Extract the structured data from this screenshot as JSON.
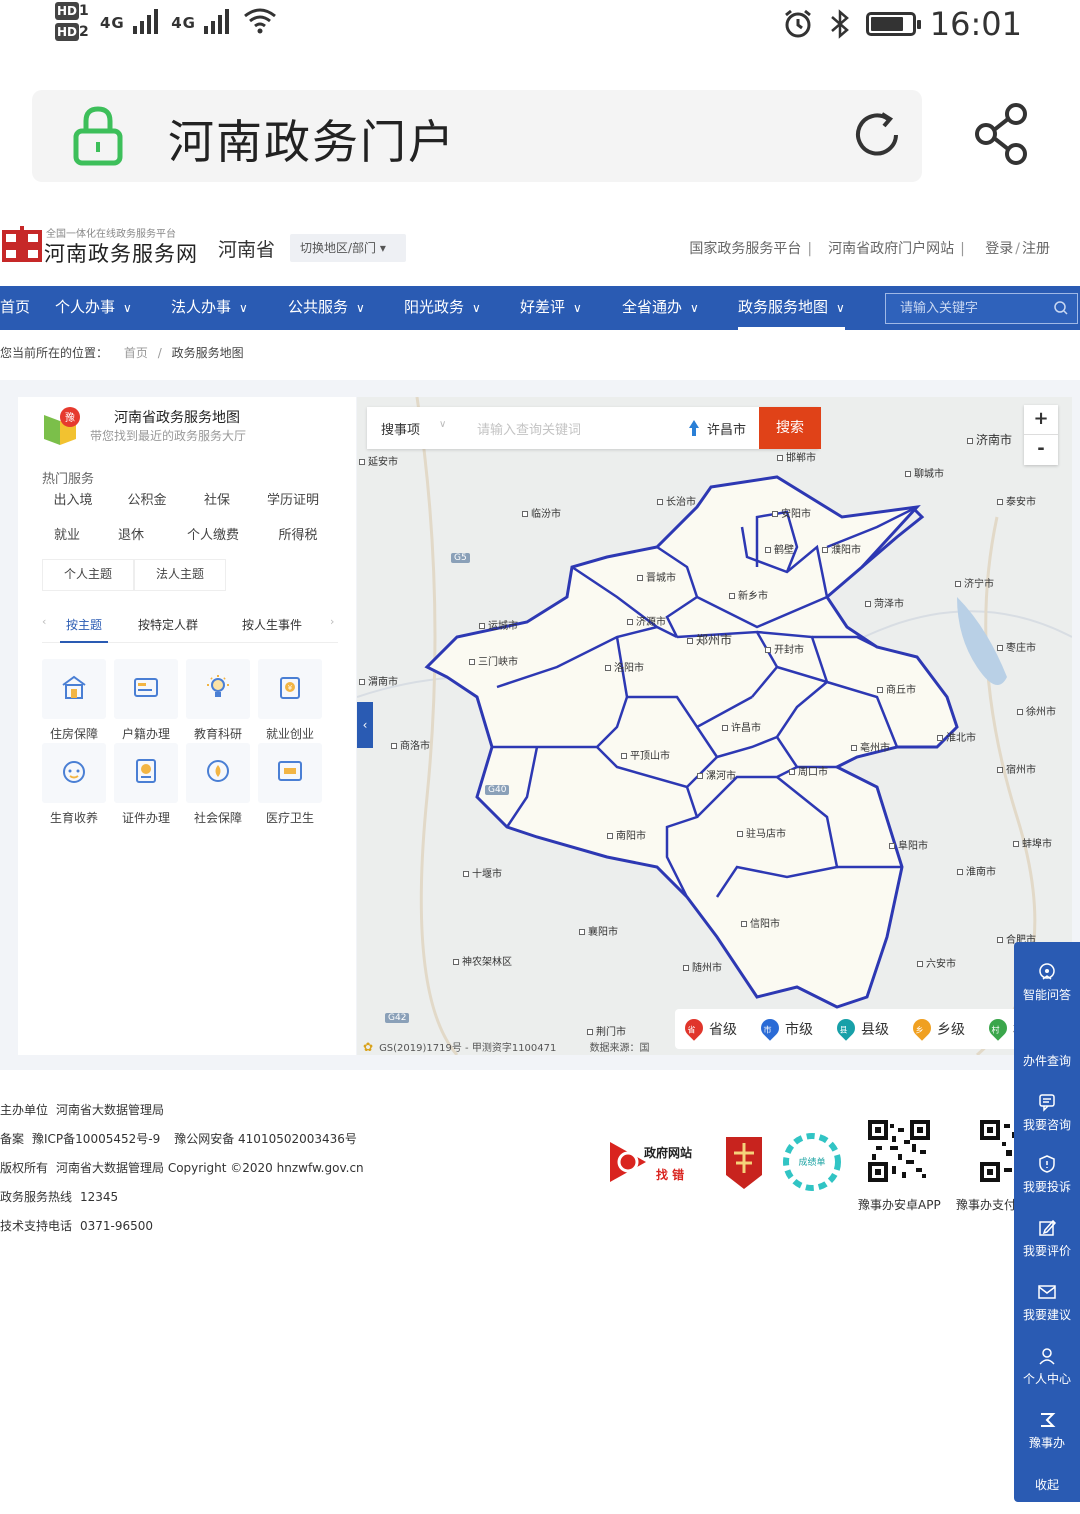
{
  "status_bar": {
    "hd1": "HD",
    "hd1_sub": "1",
    "hd2": "HD",
    "hd2_sub": "2",
    "net1": "4G",
    "net2": "4G",
    "time": "16:01"
  },
  "browser": {
    "title": "河南政务门户"
  },
  "site": {
    "logo_small": "全国一体化在线政务服务平台",
    "logo_big": "河南政务服务网",
    "province": "河南省",
    "switch_label": "切换地区/部门",
    "links": {
      "national": "国家政务服务平台",
      "portal": "河南省政府门户网站",
      "login": "登录",
      "register": "注册"
    }
  },
  "nav": {
    "items": [
      "首页",
      "个人办事",
      "法人办事",
      "公共服务",
      "阳光政务",
      "好差评",
      "全省通办",
      "政务服务地图"
    ],
    "search_placeholder": "请输入关键字"
  },
  "breadcrumb": {
    "prefix": "您当前所在的位置：",
    "home": "首页",
    "sep": "/",
    "current": "政务服务地图"
  },
  "panel": {
    "map_logo": "豫",
    "title": "河南省政务服务地图",
    "subtitle": "带您找到最近的政务服务大厅",
    "hot_title": "热门服务",
    "hot_tags": [
      "出入境",
      "公积金",
      "社保",
      "学历证明",
      "就业",
      "退休",
      "个人缴费",
      "所得税"
    ],
    "theme_tabs": [
      "个人主题",
      "法人主题"
    ],
    "sub_tabs": [
      "按主题",
      "按特定人群",
      "按人生事件"
    ],
    "services": [
      {
        "label": "住房保障",
        "icon": "house-icon"
      },
      {
        "label": "户籍办理",
        "icon": "id-card-icon"
      },
      {
        "label": "教育科研",
        "icon": "lightbulb-icon"
      },
      {
        "label": "就业创业",
        "icon": "briefcase-icon"
      },
      {
        "label": "生育收养",
        "icon": "baby-icon"
      },
      {
        "label": "证件办理",
        "icon": "certificate-icon"
      },
      {
        "label": "社会保障",
        "icon": "shield-drop-icon"
      },
      {
        "label": "医疗卫生",
        "icon": "bed-icon"
      }
    ]
  },
  "map": {
    "search_category": "搜事项",
    "search_placeholder": "请输入查询关键词",
    "location": "许昌市",
    "search_button": "搜索",
    "zoom_in": "+",
    "zoom_out": "-",
    "collapse": "‹",
    "legend": [
      {
        "label": "省级",
        "mark": "省",
        "color": "#e0352b"
      },
      {
        "label": "市级",
        "mark": "市",
        "color": "#2a6bd6"
      },
      {
        "label": "县级",
        "mark": "县",
        "color": "#17a0a8"
      },
      {
        "label": "乡级",
        "mark": "乡",
        "color": "#f0a020"
      },
      {
        "label": "村级",
        "mark": "村",
        "color": "#3aa64b"
      }
    ],
    "copyright": "GS(2019)1719号 - 甲测资字1100471",
    "source": "数据来源：国",
    "road_badges": [
      "G5",
      "G40",
      "G42"
    ],
    "cities_major": [
      {
        "name": "郑州市"
      },
      {
        "name": "济南市"
      }
    ],
    "cities": [
      "延安市",
      "邯郸市",
      "聊城市",
      "泰安市",
      "长治市",
      "临汾市",
      "安阳市",
      "鹤壁",
      "濮阳市",
      "晋城市",
      "新乡市",
      "济宁市",
      "菏泽市",
      "运城市",
      "济源市",
      "开封市",
      "三门峡市",
      "洛阳市",
      "枣庄市",
      "渭南市",
      "商丘市",
      "徐州市",
      "商洛市",
      "许昌市",
      "淮北市",
      "平顶山市",
      "亳州市",
      "漯河市",
      "周口市",
      "宿州市",
      "南阳市",
      "驻马店市",
      "阜阳市",
      "蚌埠市",
      "十堰市",
      "淮南市",
      "信阳市",
      "襄阳市",
      "合肥市",
      "神农架林区",
      "随州市",
      "六安市",
      "荆门市"
    ]
  },
  "footer": {
    "host_k": "主办单位",
    "host_v": "河南省大数据管理局",
    "record_k": "备案",
    "record_icp": "豫ICP备10005452号-9",
    "record_police": "豫公网安备 41010502003436号",
    "copy_k": "版权所有",
    "copy_v": "河南省大数据管理局 Copyright ©2020 hnzwfw.gov.cn",
    "hotline_k": "政务服务热线",
    "hotline_v": "12345",
    "tech_k": "技术支持电话",
    "tech_v": "0371-96500",
    "gov_err_title": "政府网站",
    "gov_err_sub": "找 错",
    "badge_circle": "成绩单",
    "qr1_label": "豫事办安卓APP",
    "qr2_label": "豫事办支付"
  },
  "float_bar": {
    "items": [
      "智能问答",
      "办件查询",
      "我要咨询",
      "我要投诉",
      "我要评价",
      "我要建议",
      "个人中心",
      "豫事办",
      "收起"
    ]
  }
}
